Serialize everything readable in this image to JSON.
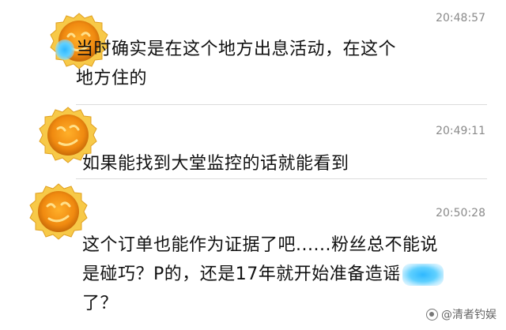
{
  "messages": [
    {
      "time": "20:48:57",
      "text_line1": "当时确实是在这个地方出息活动，在这个",
      "text_line2": "地方住的"
    },
    {
      "time": "20:49:11",
      "text_line1": "如果能找到大堂监控的话就能看到"
    },
    {
      "time": "20:50:28",
      "text_line1": "这个订单也能作为证据了吧......粉丝总不能说",
      "text_line2a": "是碰巧？P的，还是17年就开始准备造谣",
      "text_line3": "了？"
    }
  ],
  "avatar_icon": "orange-cookie-avatar-icon",
  "watermark": {
    "text": "@清者钓娱",
    "icon": "camera-logo-icon"
  },
  "colors": {
    "avatar_orange": "#f5a21c",
    "avatar_rim": "#f7c948",
    "time_gray": "#8a8a8a",
    "redaction_blue": "#3ab8ff",
    "divider": "#dcdcdc"
  }
}
